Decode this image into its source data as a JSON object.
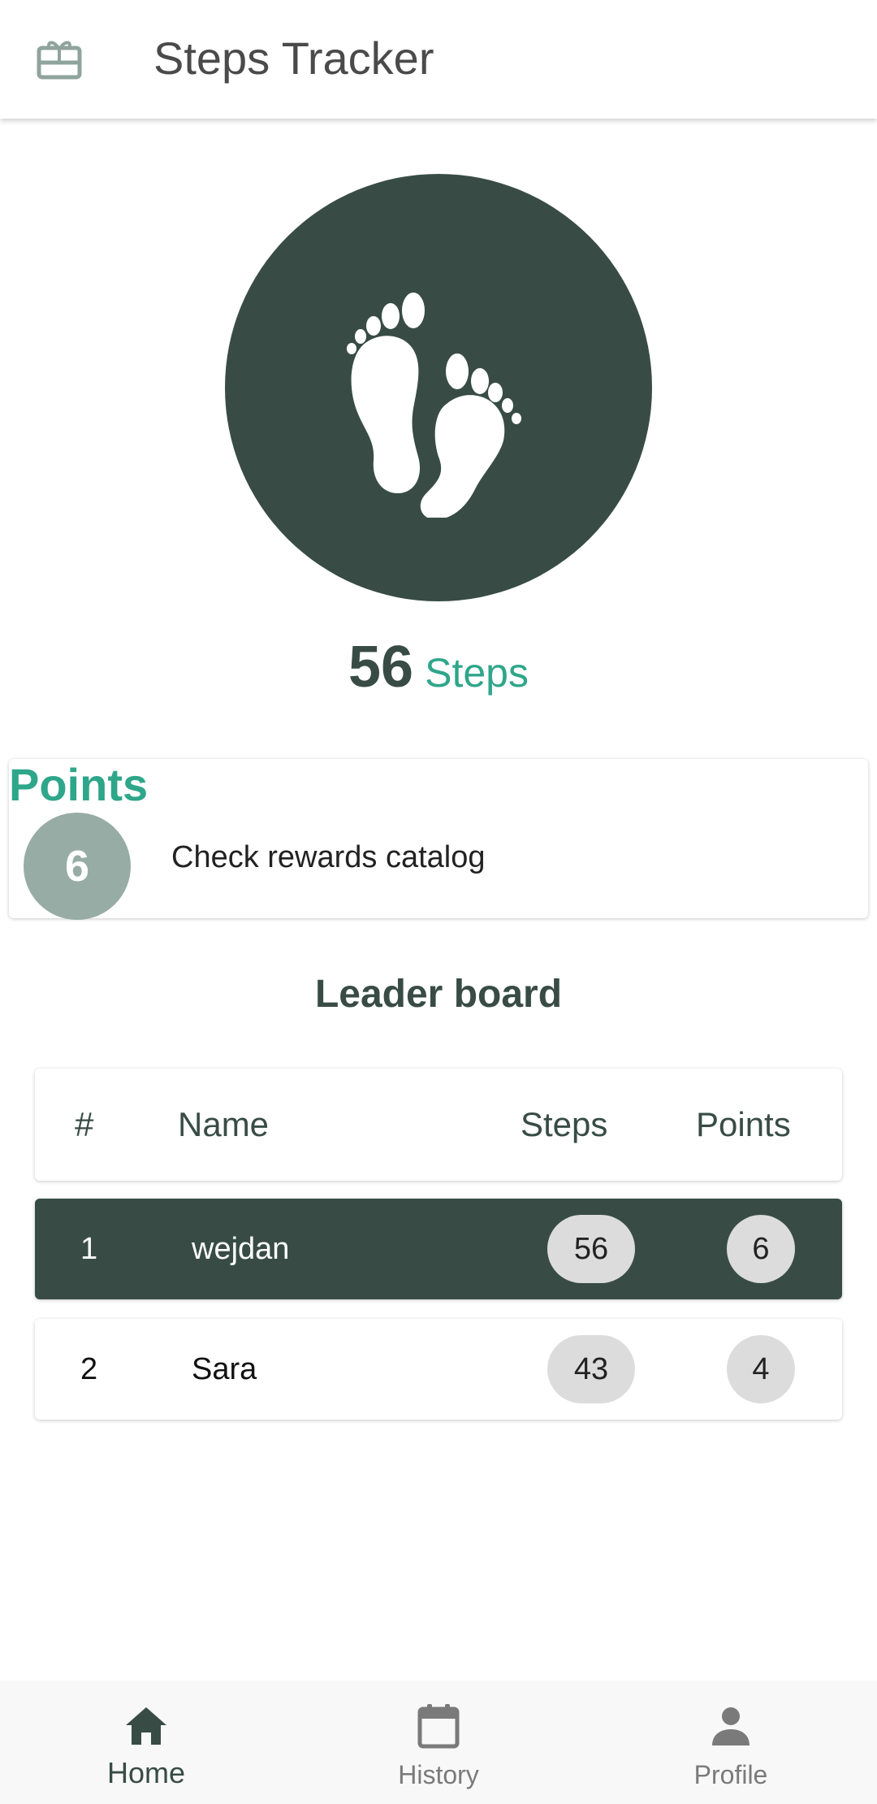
{
  "app_bar": {
    "title": "Steps Tracker",
    "icon": "gift-card-icon"
  },
  "steps": {
    "count": "56",
    "unit": "Steps",
    "icon": "footprints-icon"
  },
  "points_card": {
    "label": "Points",
    "value": "6",
    "link_text": "Check rewards catalog"
  },
  "leaderboard": {
    "title": "Leader board",
    "headers": {
      "rank": "#",
      "name": "Name",
      "steps": "Steps",
      "points": "Points"
    },
    "rows": [
      {
        "rank": "1",
        "name": "wejdan",
        "steps": "56",
        "points": "6"
      },
      {
        "rank": "2",
        "name": "Sara",
        "steps": "43",
        "points": "4"
      }
    ]
  },
  "bottom_nav": {
    "items": [
      {
        "label": "Home",
        "icon": "home-icon",
        "active": true
      },
      {
        "label": "History",
        "icon": "calendar-icon",
        "active": false
      },
      {
        "label": "Profile",
        "icon": "person-icon",
        "active": false
      }
    ]
  },
  "colors": {
    "primary": "#384c45",
    "accent": "#2ea68a",
    "badge": "#97aca4",
    "pill": "#dcdcdc"
  }
}
